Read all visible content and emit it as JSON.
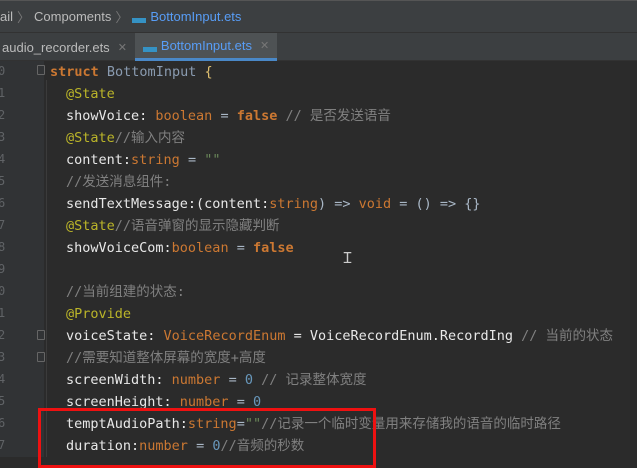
{
  "breadcrumb": {
    "items": [
      "ail",
      "Compoments",
      "BottomInput.ets"
    ]
  },
  "tabs": [
    {
      "label": "audio_recorder.ets",
      "active": false
    },
    {
      "label": "BottomInput.ets",
      "active": true
    }
  ],
  "line_numbers": [
    "0",
    "1",
    "2",
    "3",
    "4",
    "5",
    "6",
    "7",
    "8",
    "9",
    "0",
    "1",
    "2",
    "3",
    "4",
    "5",
    "6",
    "7"
  ],
  "code": {
    "l0": [
      "struct",
      "BottomInput",
      "{"
    ],
    "l1": "@State",
    "l2": [
      "showVoice: ",
      "boolean",
      " = ",
      "false",
      " // 是否发送语音"
    ],
    "l3": [
      "@State",
      "//输入内容"
    ],
    "l4": [
      "content:",
      "string",
      " = ",
      "\"\""
    ],
    "l5": "//发送消息组件:",
    "l6": [
      "sendTextMessage:(content:",
      "string",
      ") => ",
      "void",
      " = () => {}"
    ],
    "l7": [
      "@State",
      "//语音弹窗的显示隐藏判断"
    ],
    "l8": [
      "showVoiceCom:",
      "boolean",
      " = ",
      "false"
    ],
    "l10": "//当前组建的状态:",
    "l11": "@Provide",
    "l12": [
      "voiceState: ",
      "VoiceRecordEnum",
      " = VoiceRecordEnum.RecordIng ",
      "// 当前的状态"
    ],
    "l13": "//需要知道整体屏幕的宽度+高度",
    "l14": [
      "screenWidth: ",
      "number",
      " = ",
      "0",
      " // 记录整体宽度"
    ],
    "l15": [
      "screenHeight: ",
      "number",
      " = ",
      "0"
    ],
    "l16": [
      "temptAudioPath:",
      "string",
      "=",
      "\"\"",
      "//记录一个临时变量用来存储我的语音的临时路径"
    ],
    "l17": [
      "duration:",
      "number",
      " = ",
      "0",
      "//音频的秒数"
    ]
  },
  "colors": {
    "highlight_box": "#ee1111",
    "active_tab": "#589df6"
  }
}
